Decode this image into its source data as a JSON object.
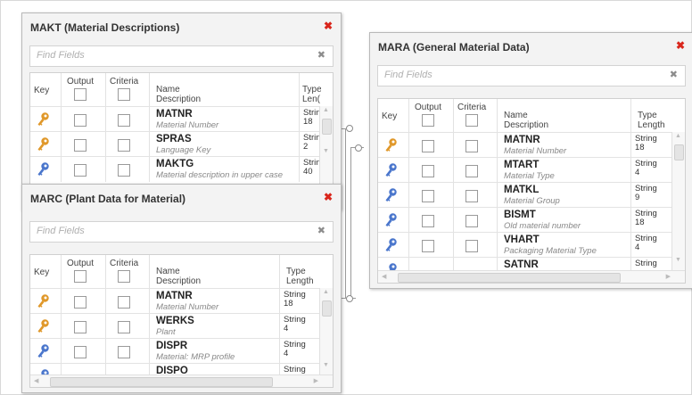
{
  "search_placeholder": "Find Fields",
  "colors": {
    "close": "#d9261c",
    "primary_key": "#e0982a",
    "foreign_key": "#4a76cc"
  },
  "columns": {
    "key": "Key",
    "output": "Output",
    "criteria": "Criteria",
    "name": "Name",
    "description": "Description",
    "type": "Type",
    "length": "Length"
  },
  "makt": {
    "title": "MAKT (Material Descriptions)",
    "type_header": "Type",
    "length_header": "Len(",
    "rows": [
      {
        "name": "MATNR",
        "desc": "Material Number",
        "type": "Strin",
        "length": "18",
        "key": "primary-key-icon"
      },
      {
        "name": "SPRAS",
        "desc": "Language Key",
        "type": "Strin",
        "length": "2",
        "key": "primary-key-icon"
      },
      {
        "name": "MAKTG",
        "desc": "Material description in upper case",
        "type": "Strin",
        "length": "40",
        "key": "foreign-key-icon"
      }
    ]
  },
  "marc": {
    "title": "MARC (Plant Data for Material)",
    "rows": [
      {
        "name": "MATNR",
        "desc": "Material Number",
        "type": "String",
        "length": "18",
        "key": "primary-key-icon"
      },
      {
        "name": "WERKS",
        "desc": "Plant",
        "type": "String",
        "length": "4",
        "key": "primary-key-icon"
      },
      {
        "name": "DISPR",
        "desc": "Material: MRP profile",
        "type": "String",
        "length": "4",
        "key": "foreign-key-icon"
      },
      {
        "name": "DISPO",
        "desc": "",
        "type": "String",
        "length": "",
        "key": "foreign-key-icon"
      }
    ]
  },
  "mara": {
    "title": "MARA (General Material Data)",
    "rows": [
      {
        "name": "MATNR",
        "desc": "Material Number",
        "type": "String",
        "length": "18",
        "key": "primary-key-icon"
      },
      {
        "name": "MTART",
        "desc": "Material Type",
        "type": "String",
        "length": "4",
        "key": "foreign-key-icon"
      },
      {
        "name": "MATKL",
        "desc": "Material Group",
        "type": "String",
        "length": "9",
        "key": "foreign-key-icon"
      },
      {
        "name": "BISMT",
        "desc": "Old material number",
        "type": "String",
        "length": "18",
        "key": "foreign-key-icon"
      },
      {
        "name": "VHART",
        "desc": "Packaging Material Type",
        "type": "String",
        "length": "4",
        "key": "foreign-key-icon"
      },
      {
        "name": "SATNR",
        "desc": "",
        "type": "String",
        "length": "",
        "key": "foreign-key-icon"
      }
    ]
  }
}
